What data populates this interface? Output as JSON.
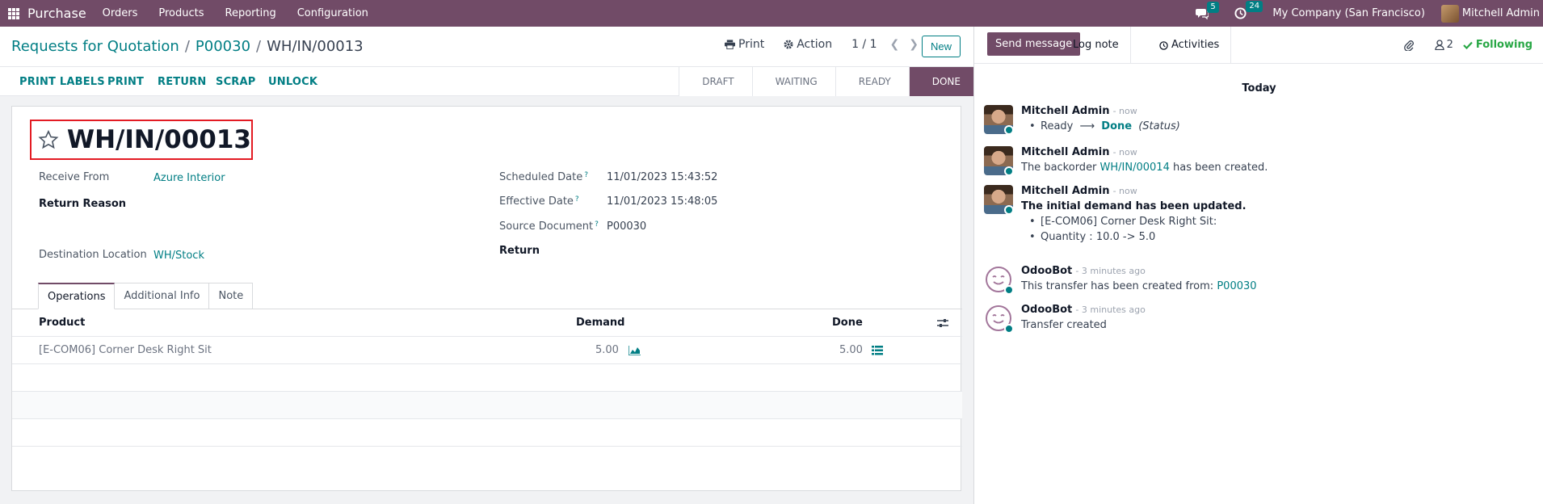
{
  "navbar": {
    "app_name": "Purchase",
    "menu": [
      "Orders",
      "Products",
      "Reporting",
      "Configuration"
    ],
    "messages_count": "5",
    "activities_count": "24",
    "company": "My Company (San Francisco)",
    "user": "Mitchell Admin"
  },
  "control": {
    "breadcrumbs": [
      "Requests for Quotation",
      "P00030",
      "WH/IN/00013"
    ],
    "print_label": "Print",
    "action_label": "Action",
    "pager": "1 / 1",
    "new_label": "New"
  },
  "status": {
    "actions": [
      "PRINT LABELS",
      "PRINT",
      "RETURN",
      "SCRAP",
      "UNLOCK"
    ],
    "stages": [
      "DRAFT",
      "WAITING",
      "READY",
      "DONE"
    ],
    "current_stage": "DONE"
  },
  "record": {
    "title": "WH/IN/00013",
    "receive_from_label": "Receive From",
    "receive_from": "Azure Interior",
    "return_reason_label": "Return Reason",
    "destination_label": "Destination Location",
    "destination": "WH/Stock",
    "scheduled_label": "Scheduled Date",
    "scheduled": "11/01/2023 15:43:52",
    "effective_label": "Effective Date",
    "effective": "11/01/2023 15:48:05",
    "source_label": "Source Document",
    "source": "P00030",
    "return_label": "Return"
  },
  "tabs": [
    "Operations",
    "Additional Info",
    "Note"
  ],
  "operations": {
    "headers": {
      "product": "Product",
      "demand": "Demand",
      "done": "Done"
    },
    "rows": [
      {
        "product": "[E-COM06] Corner Desk Right Sit",
        "demand": "5.00",
        "done": "5.00"
      }
    ]
  },
  "chatter": {
    "send_message": "Send message",
    "log_note": "Log note",
    "activities": "Activities",
    "followers_count": "2",
    "following": "Following",
    "day": "Today",
    "messages": [
      {
        "author": "Mitchell Admin",
        "when": "- now",
        "status_from": "Ready",
        "status_to": "Done",
        "status_field": "(Status)"
      },
      {
        "author": "Mitchell Admin",
        "when": "- now",
        "text_before": "The backorder",
        "link": "WH/IN/00014",
        "text_after": "has been created."
      },
      {
        "author": "Mitchell Admin",
        "when": "- now",
        "heading": "The initial demand has been updated.",
        "items": [
          "[E-COM06] Corner Desk Right Sit:",
          "Quantity : 10.0 -> 5.0"
        ]
      },
      {
        "author": "OdooBot",
        "when": "- 3 minutes ago",
        "text_before": "This transfer has been created from:",
        "link": "P00030"
      },
      {
        "author": "OdooBot",
        "when": "- 3 minutes ago",
        "text": "Transfer created"
      }
    ]
  }
}
